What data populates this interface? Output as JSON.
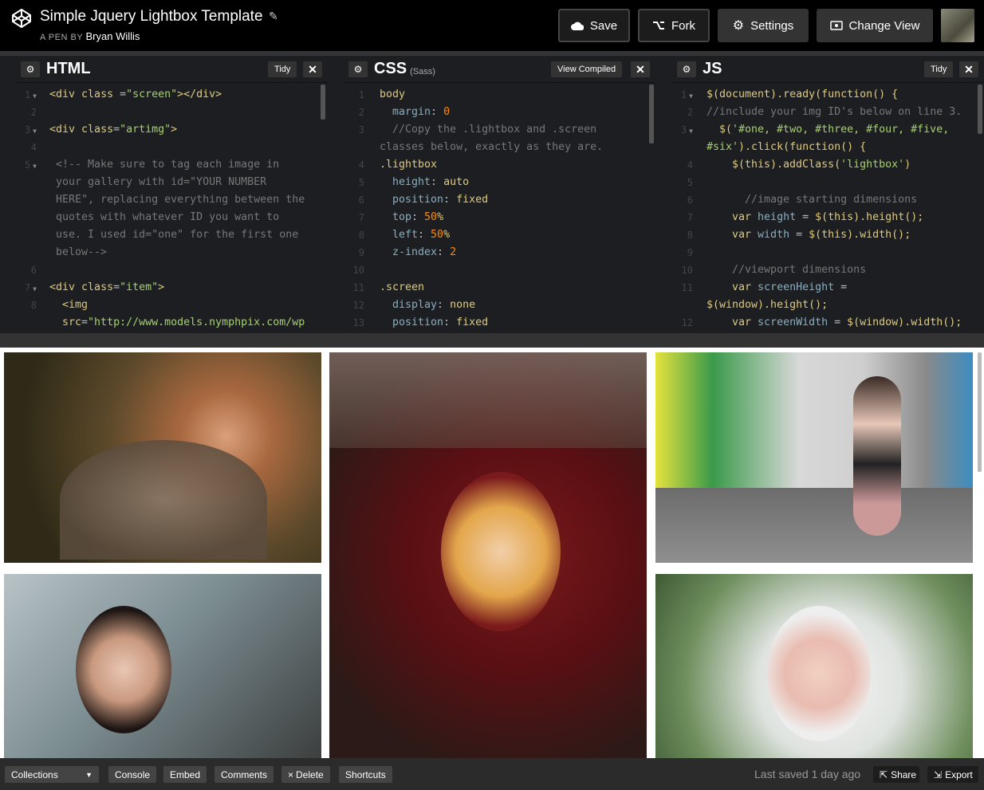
{
  "header": {
    "title": "Simple Jquery Lightbox Template",
    "byline_prefix": "A PEN BY",
    "author": "Bryan Willis",
    "buttons": {
      "save": "Save",
      "fork": "Fork",
      "settings": "Settings",
      "change_view": "Change View"
    }
  },
  "editors": {
    "html": {
      "title": "HTML",
      "tidy": "Tidy"
    },
    "css": {
      "title": "CSS",
      "sub": "(Sass)",
      "view_compiled": "View Compiled"
    },
    "js": {
      "title": "JS",
      "tidy": "Tidy"
    }
  },
  "footer": {
    "collections": "Collections",
    "console": "Console",
    "embed": "Embed",
    "comments": "Comments",
    "delete": "Delete",
    "shortcuts": "Shortcuts",
    "last_saved": "Last saved 1 day ago",
    "share": "Share",
    "export": "Export"
  },
  "icons": [
    "codepen-logo-icon",
    "pencil-icon",
    "cloud-icon",
    "fork-icon",
    "gear-icon",
    "eye-icon",
    "close-icon",
    "chevron-down-icon",
    "share-icon",
    "export-icon"
  ]
}
